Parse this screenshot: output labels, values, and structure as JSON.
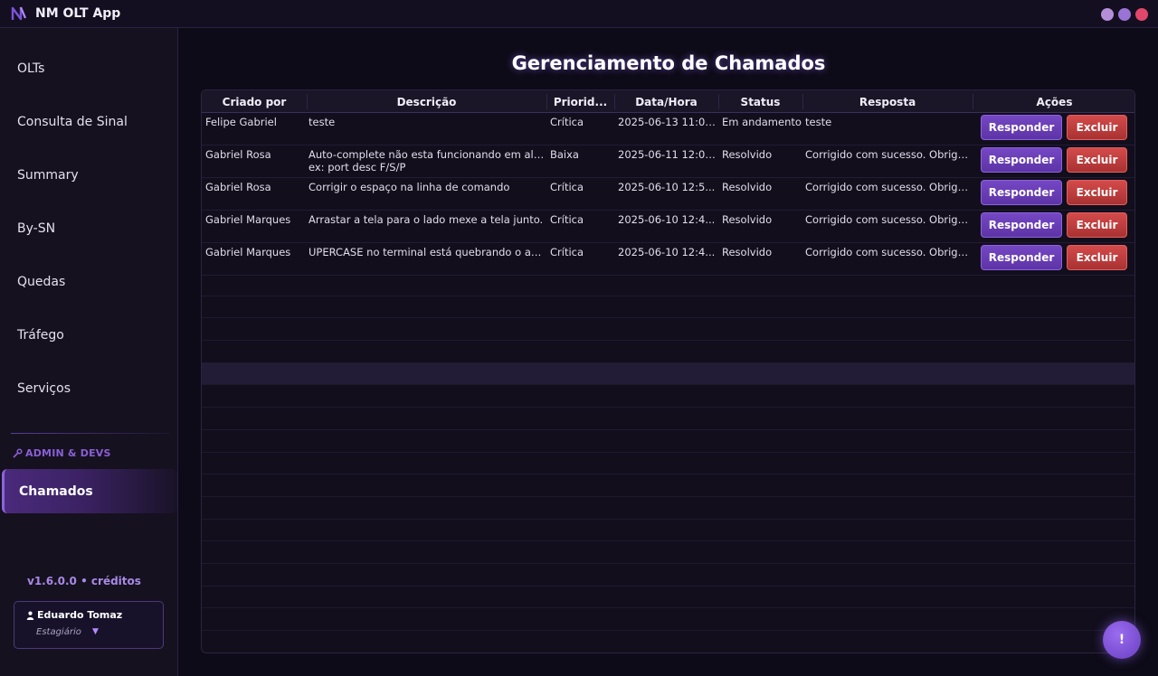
{
  "app": {
    "title": "NM OLT App"
  },
  "colors": {
    "accent": "#8d62e0",
    "danger": "#d44a4a",
    "background": "#0e0b18"
  },
  "window_controls": [
    {
      "name": "minimize",
      "color": "#b58ed9"
    },
    {
      "name": "maximize",
      "color": "#9a73d6"
    },
    {
      "name": "close",
      "color": "#e0476a"
    }
  ],
  "sidebar": {
    "items": [
      {
        "label": "OLTs"
      },
      {
        "label": "Consulta de Sinal"
      },
      {
        "label": "Summary"
      },
      {
        "label": "By-SN"
      },
      {
        "label": "Quedas"
      },
      {
        "label": "Tráfego"
      },
      {
        "label": "Serviços"
      }
    ],
    "section_label": "ADMIN & DEVS",
    "section_icon": "wrench-icon",
    "active_item": {
      "label": "Chamados"
    },
    "version": "v1.6.0.0 • créditos",
    "user": {
      "name": "Eduardo Tomaz",
      "role": "Estagiário"
    }
  },
  "main": {
    "title": "Gerenciamento de Chamados",
    "table": {
      "columns": [
        "Criado por",
        "Descrição",
        "Priorid...",
        "Data/Hora",
        "Status",
        "Resposta",
        "Ações"
      ],
      "rows": [
        {
          "criado_por": "Felipe Gabriel",
          "descricao": "teste",
          "descricao_line2": "",
          "prioridade": "Crítica",
          "data_hora": "2025-06-13 11:07...",
          "status": "Em andamento",
          "resposta": "teste"
        },
        {
          "criado_por": "Gabriel Rosa",
          "descricao": "Auto-complete não esta funcionando em alg...",
          "descricao_line2": "ex: port desc F/S/P",
          "prioridade": "Baixa",
          "data_hora": "2025-06-11 12:06...",
          "status": "Resolvido",
          "resposta": "Corrigido com sucesso. Obriga..."
        },
        {
          "criado_por": "Gabriel Rosa",
          "descricao": "Corrigir o espaço na linha de comando",
          "descricao_line2": "",
          "prioridade": "Crítica",
          "data_hora": "2025-06-10 12:5...",
          "status": "Resolvido",
          "resposta": "Corrigido com sucesso. Obriga..."
        },
        {
          "criado_por": "Gabriel Marques",
          "descricao": "Arrastar a tela para o lado mexe a tela junto.",
          "descricao_line2": "",
          "prioridade": "Crítica",
          "data_hora": "2025-06-10 12:4...",
          "status": "Resolvido",
          "resposta": "Corrigido com sucesso. Obriga..."
        },
        {
          "criado_por": "Gabriel Marques",
          "descricao": "UPERCASE no terminal está quebrando o aut...",
          "descricao_line2": "",
          "prioridade": "Crítica",
          "data_hora": "2025-06-10 12:4...",
          "status": "Resolvido",
          "resposta": "Corrigido com sucesso. Obriga..."
        }
      ],
      "actions": {
        "respond_label": "Responder",
        "delete_label": "Excluir"
      }
    }
  },
  "fab": {
    "label": "!"
  }
}
